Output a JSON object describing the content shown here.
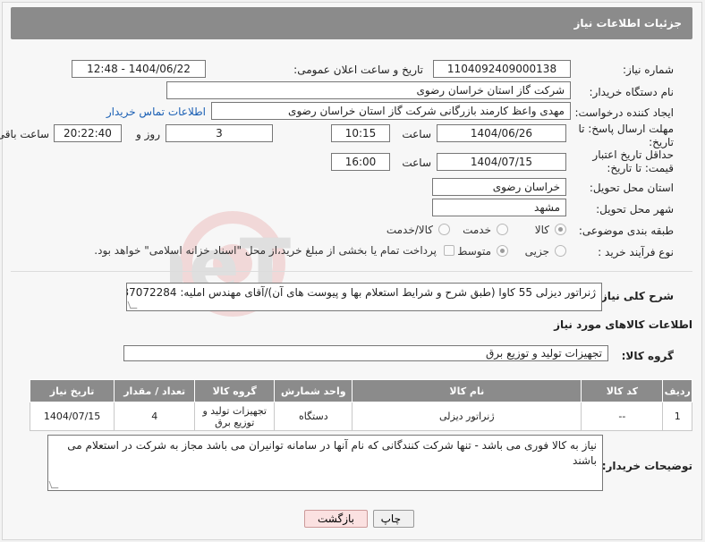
{
  "header": {
    "title": "جزئیات اطلاعات نیاز"
  },
  "form": {
    "need_number_label": "شماره نیاز:",
    "need_number": "1104092409000138",
    "announce_label": "تاریخ و ساعت اعلان عمومی:",
    "announce_value": "1404/06/22 - 12:48",
    "buyer_org_label": "نام دستگاه خریدار:",
    "buyer_org": "شرکت گاز استان خراسان رضوی",
    "creator_label": "ایجاد کننده درخواست:",
    "creator": "مهدی واعظ کارمند بازرگانی شرکت گاز استان خراسان رضوی",
    "contact_link": "اطلاعات تماس خریدار",
    "reply_deadline_label": "مهلت ارسال پاسخ: تا تاریخ:",
    "reply_date": "1404/06/26",
    "time_label": "ساعت",
    "reply_time": "10:15",
    "days_count": "3",
    "days_label": "روز و",
    "remaining_time": "20:22:40",
    "remaining_label": "ساعت باقی مانده",
    "price_validity_label": "حداقل تاریخ اعتبار قیمت: تا تاریخ:",
    "price_date": "1404/07/15",
    "price_time": "16:00",
    "province_label": "استان محل تحویل:",
    "province": "خراسان رضوی",
    "city_label": "شهر محل تحویل:",
    "city": "مشهد",
    "category_label": "طبقه بندی موضوعی:",
    "category_options": [
      "کالا",
      "خدمت",
      "کالا/خدمت"
    ],
    "process_label": "نوع فرآیند خرید :",
    "process_options": [
      "جزیی",
      "متوسط"
    ],
    "payment_note": "پرداخت تمام یا بخشی از مبلغ خرید،از محل \"اسناد خزانه اسلامی\" خواهد بود.",
    "description_label": "شرح کلی نیاز:",
    "description": "ژنراتور دیزلی 55 کاوا (طبق شرح و شرایط استعلام بها و پیوست های آن)/آقای مهندس املیه: 37072284-051"
  },
  "items_section": {
    "title": "اطلاعات کالاهای مورد نیاز",
    "group_label": "گروه کالا:",
    "group_value": "تجهیزات تولید و توزیع برق",
    "columns": [
      "ردیف",
      "کد کالا",
      "نام کالا",
      "واحد شمارش",
      "گروه کالا",
      "تعداد / مقدار",
      "تاریخ نیاز"
    ],
    "rows": [
      [
        "1",
        "--",
        "ژنراتور دیزلی",
        "دستگاه",
        "تجهیزات تولید و توزیع برق",
        "4",
        "1404/07/15"
      ]
    ]
  },
  "buyer_notes": {
    "label": "توضیحات خریدار:",
    "text": "نیاز به کالا فوری می باشد - تنها شرکت کنندگانی که نام آنها در سامانه توانیران می باشد مجاز به شرکت در استعلام می باشند"
  },
  "buttons": {
    "print": "چاپ",
    "back": "بازگشت"
  },
  "watermark": {
    "text": "AriaTender.neT"
  }
}
